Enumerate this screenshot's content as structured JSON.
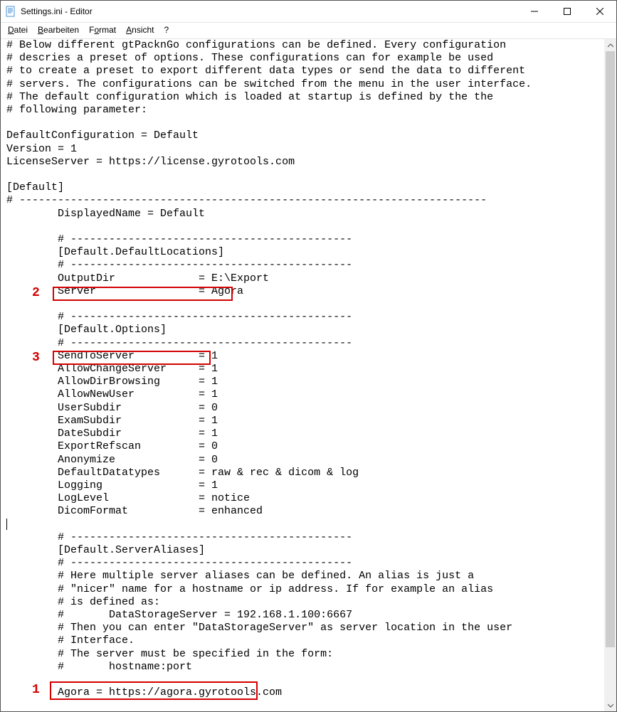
{
  "window": {
    "title": "Settings.ini - Editor"
  },
  "menubar": {
    "items": [
      {
        "label": "Datei",
        "underline_index": 0
      },
      {
        "label": "Bearbeiten",
        "underline_index": 0
      },
      {
        "label": "Format",
        "underline_index": 1
      },
      {
        "label": "Ansicht",
        "underline_index": 0
      },
      {
        "label": "?",
        "underline_index": -1
      }
    ]
  },
  "editor": {
    "lines": [
      "# Below different gtPacknGo configurations can be defined. Every configuration",
      "# descries a preset of options. These configurations can for example be used",
      "# to create a preset to export different data types or send the data to different",
      "# servers. The configurations can be switched from the menu in the user interface.",
      "# The default configuration which is loaded at startup is defined by the the",
      "# following parameter:",
      "",
      "DefaultConfiguration = Default",
      "Version = 1",
      "LicenseServer = https://license.gyrotools.com",
      "",
      "[Default]",
      "# -------------------------------------------------------------------------",
      "        DisplayedName = Default",
      "",
      "        # --------------------------------------------",
      "        [Default.DefaultLocations]",
      "        # --------------------------------------------",
      "        OutputDir             = E:\\Export",
      "        Server                = Agora",
      "",
      "        # --------------------------------------------",
      "        [Default.Options]",
      "        # --------------------------------------------",
      "        SendToServer          = 1",
      "        AllowChangeServer     = 1",
      "        AllowDirBrowsing      = 1",
      "        AllowNewUser          = 1",
      "        UserSubdir            = 0",
      "        ExamSubdir            = 1",
      "        DateSubdir            = 1",
      "        ExportRefscan         = 0",
      "        Anonymize             = 0",
      "        DefaultDatatypes      = raw & rec & dicom & log",
      "        Logging               = 1",
      "        LogLevel              = notice",
      "        DicomFormat           = enhanced",
      "",
      "        # --------------------------------------------",
      "        [Default.ServerAliases]",
      "        # --------------------------------------------",
      "        # Here multiple server aliases can be defined. An alias is just a",
      "        # \"nicer\" name for a hostname or ip address. If for example an alias",
      "        # is defined as:",
      "        #       DataStorageServer = 192.168.1.100:6667",
      "        # Then you can enter \"DataStorageServer\" as server location in the user",
      "        # Interface.",
      "        # The server must be specified in the form:",
      "        #       hostname:port",
      "",
      "        Agora = https://agora.gyrotools.com",
      ""
    ]
  },
  "annotations": {
    "box1": {
      "label": "1"
    },
    "box2": {
      "label": "2"
    },
    "box3": {
      "label": "3"
    }
  }
}
